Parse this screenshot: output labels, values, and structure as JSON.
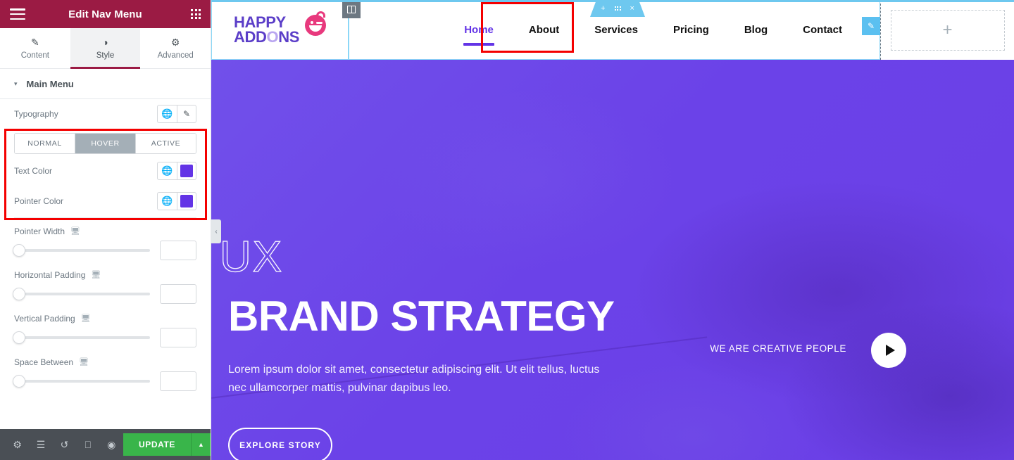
{
  "panel": {
    "header": {
      "title": "Edit Nav Menu",
      "menu_icon": "hamburger-icon",
      "apps_icon": "apps-grid-icon"
    },
    "tabs": [
      {
        "label": "Content",
        "icon": "pencil-icon",
        "active": false
      },
      {
        "label": "Style",
        "icon": "half-circle-icon",
        "active": true
      },
      {
        "label": "Advanced",
        "icon": "gear-icon",
        "active": false
      }
    ],
    "section": {
      "label": "Main Menu",
      "caret": "▾"
    },
    "typography": {
      "label": "Typography",
      "globe_icon": "globe-icon",
      "edit_icon": "pencil-icon"
    },
    "state_tabs": [
      {
        "label": "NORMAL",
        "active": false
      },
      {
        "label": "HOVER",
        "active": true
      },
      {
        "label": "ACTIVE",
        "active": false
      }
    ],
    "colors": [
      {
        "label": "Text Color",
        "globe_icon": "globe-icon",
        "value": "#6334E6"
      },
      {
        "label": "Pointer Color",
        "globe_icon": "globe-icon",
        "value": "#6334E6"
      }
    ],
    "sliders": [
      {
        "label": "Pointer Width",
        "device_icon": "desktop-icon",
        "value": ""
      },
      {
        "label": "Horizontal Padding",
        "device_icon": "desktop-icon",
        "value": ""
      },
      {
        "label": "Vertical Padding",
        "device_icon": "desktop-icon",
        "value": ""
      },
      {
        "label": "Space Between",
        "device_icon": "desktop-icon",
        "value": ""
      }
    ],
    "footer": {
      "icons": [
        {
          "name": "settings-gear-icon",
          "glyph": "⚙"
        },
        {
          "name": "navigator-layers-icon",
          "glyph": "☰"
        },
        {
          "name": "history-icon",
          "glyph": "↺"
        },
        {
          "name": "responsive-mode-icon",
          "glyph": "❐"
        },
        {
          "name": "preview-eye-icon",
          "glyph": "◉"
        }
      ],
      "update_label": "UPDATE",
      "update_caret": "▲",
      "update_color": "#39B54A"
    },
    "collapse_handle": "‹"
  },
  "canvas": {
    "logo": {
      "line1": "HAPPY",
      "line2_a": "ADD",
      "line2_o": "O",
      "line2_b": "NS"
    },
    "nav_items": [
      {
        "label": "Home",
        "state": "hover"
      },
      {
        "label": "About",
        "state": "normal"
      },
      {
        "label": "Services",
        "state": "normal"
      },
      {
        "label": "Pricing",
        "state": "normal"
      },
      {
        "label": "Blog",
        "state": "normal"
      },
      {
        "label": "Contact",
        "state": "normal"
      }
    ],
    "add_widget": "+",
    "section_handle": {
      "add": "+",
      "drag": "drag-dots-icon",
      "close": "×"
    },
    "column_handle": "column-icon",
    "edit_pencil": "✎",
    "hero": {
      "eyebrow": "UX",
      "headline": "BRAND STRATEGY",
      "paragraph": "Lorem ipsum dolor sit amet, consectetur adipiscing elit. Ut elit tellus, luctus nec ullamcorper mattis, pulvinar dapibus leo.",
      "cta_label": "EXPLORE STORY",
      "video_label": "WE ARE CREATIVE PEOPLE",
      "play_icon": "play-triangle-icon"
    }
  },
  "annotations": {
    "color": "#F40000"
  }
}
